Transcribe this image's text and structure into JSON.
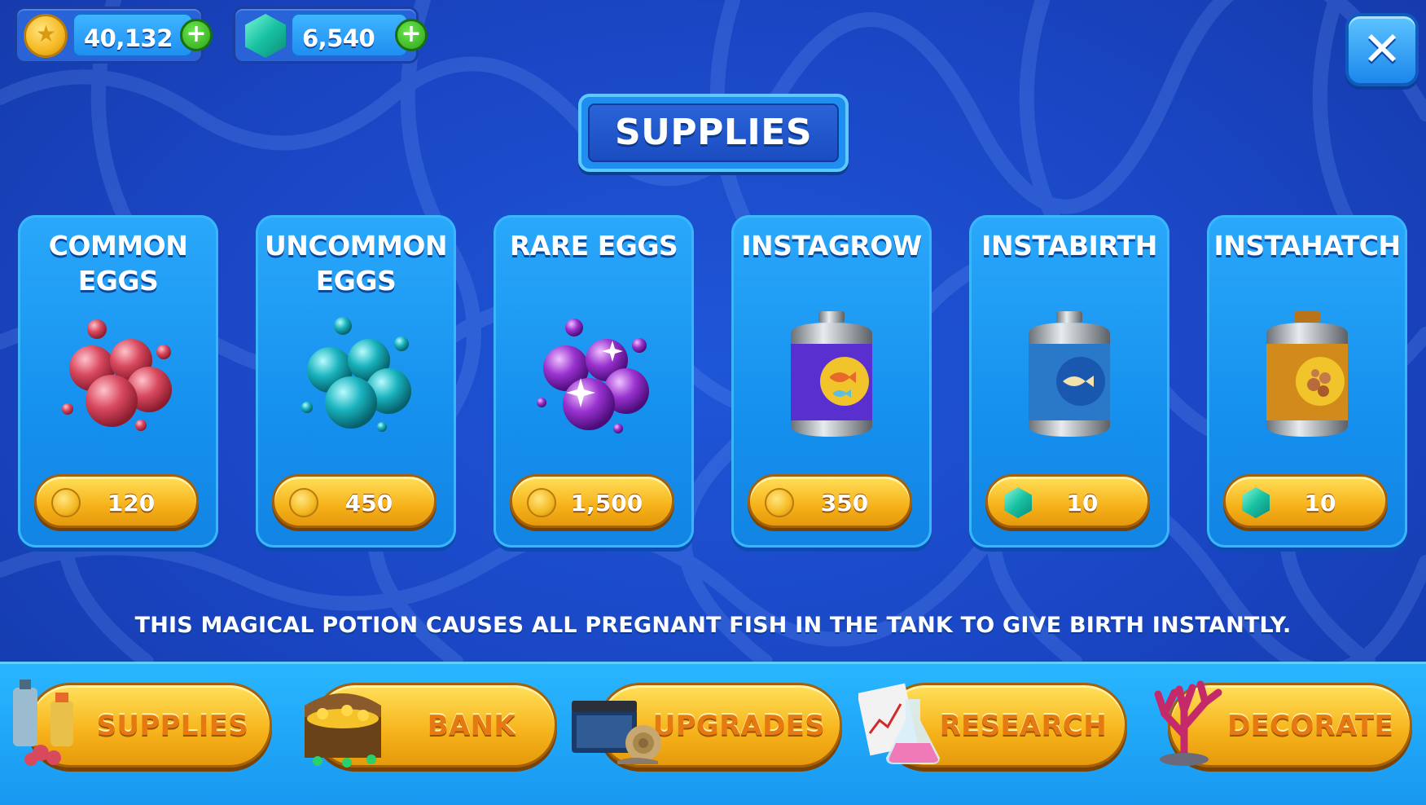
{
  "currencies": [
    {
      "type": "coins",
      "amount": "40,132",
      "add_label": "+",
      "icon": "coin-icon"
    },
    {
      "type": "gems",
      "amount": "6,540",
      "add_label": "+",
      "icon": "gem-icon"
    }
  ],
  "close_label": "✕",
  "title": "SUPPLIES",
  "items": [
    {
      "name_line1": "COMMON",
      "name_line2": "EGGS",
      "price": "120",
      "currency": "coin",
      "icon": "red-eggs-icon",
      "color": "#d44a5c"
    },
    {
      "name_line1": "UNCOMMON",
      "name_line2": "EGGS",
      "price": "450",
      "currency": "coin",
      "icon": "teal-eggs-icon",
      "color": "#1ab5bf"
    },
    {
      "name_line1": "RARE EGGS",
      "name_line2": "",
      "price": "1,500",
      "currency": "coin",
      "icon": "purple-eggs-icon",
      "color": "#9a32d0"
    },
    {
      "name_line1": "INSTAGROW",
      "name_line2": "",
      "price": "350",
      "currency": "coin",
      "icon": "instagrow-potion-icon",
      "color": "#5a2fd0"
    },
    {
      "name_line1": "INSTABIRTH",
      "name_line2": "",
      "price": "10",
      "currency": "gem",
      "icon": "instabirth-potion-icon",
      "color": "#2a78c8"
    },
    {
      "name_line1": "INSTAHATCH",
      "name_line2": "",
      "price": "10",
      "currency": "gem",
      "icon": "instahatch-potion-icon",
      "color": "#d28a1a"
    }
  ],
  "description": "THIS MAGICAL POTION CAUSES ALL PREGNANT FISH IN THE TANK TO GIVE BIRTH INSTANTLY.",
  "nav": [
    {
      "label": "SUPPLIES",
      "icon": "supplies-bottles-icon"
    },
    {
      "label": "BANK",
      "icon": "treasure-chest-icon"
    },
    {
      "label": "UPGRADES",
      "icon": "aquarium-snail-icon"
    },
    {
      "label": "RESEARCH",
      "icon": "flask-chart-icon"
    },
    {
      "label": "DECORATE",
      "icon": "coral-icon"
    }
  ]
}
